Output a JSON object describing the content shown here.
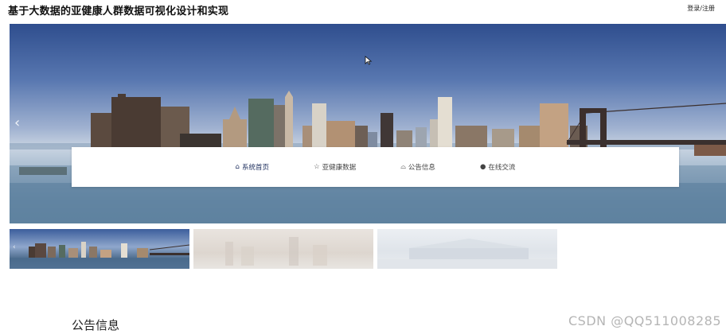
{
  "header": {
    "title": "基于大数据的亚健康人群数据可视化设计和实现",
    "login_label": "登录/注册"
  },
  "carousel": {
    "prev_icon": "chevron-left-icon",
    "slide_count": 3,
    "active_slide": 1
  },
  "nav": {
    "items": [
      {
        "label": "系统首页",
        "icon": "home-icon",
        "glyph": "⌂",
        "active": true
      },
      {
        "label": "亚健康数据",
        "icon": "star-icon",
        "glyph": "☆",
        "active": false
      },
      {
        "label": "公告信息",
        "icon": "bell-icon",
        "glyph": "⌓",
        "active": false
      },
      {
        "label": "在线交流",
        "icon": "info-icon",
        "glyph": "●",
        "active": false
      }
    ]
  },
  "section": {
    "notice_heading": "公告信息"
  },
  "watermark": "CSDN @QQ511008285"
}
